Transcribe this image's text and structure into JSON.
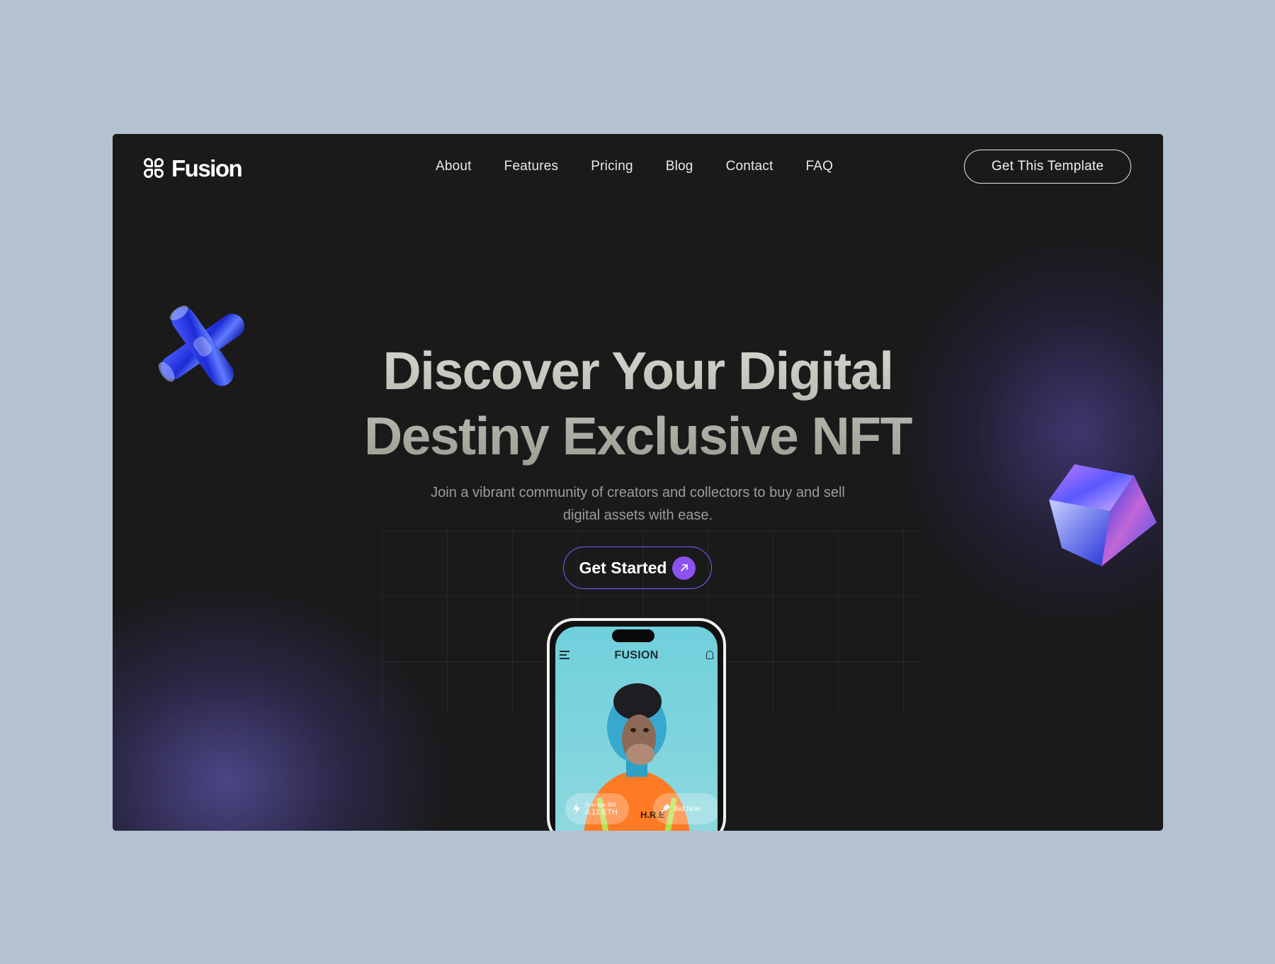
{
  "brand": {
    "name": "Fusion"
  },
  "nav": {
    "items": [
      "About",
      "Features",
      "Pricing",
      "Blog",
      "Contact",
      "FAQ"
    ]
  },
  "header": {
    "cta_label": "Get This Template"
  },
  "hero": {
    "title_line1": "Discover Your Digital",
    "title_line2": "Destiny Exclusive NFT",
    "subtitle_line1": "Join a vibrant community of creators and collectors to buy and sell",
    "subtitle_line2": "digital assets with ease.",
    "button_label": "Get Started"
  },
  "phone": {
    "app_title": "FUSION",
    "avg_bid_label": "Average Bid",
    "avg_bid_value": "0.11 ETH",
    "bid_now_label": "Bid Now",
    "shirt_text": "H.R.E"
  },
  "colors": {
    "page_bg": "#b4c1d1",
    "frame_bg": "#1a1a1b",
    "accent": "#8b52f0",
    "button_border": "#7c5cff",
    "phone_screen": "#6fd0dc"
  },
  "icons": [
    "fusion-logo-icon",
    "arrow-up-right-icon",
    "menu-icon",
    "bell-icon",
    "lightning-icon",
    "gavel-icon"
  ]
}
